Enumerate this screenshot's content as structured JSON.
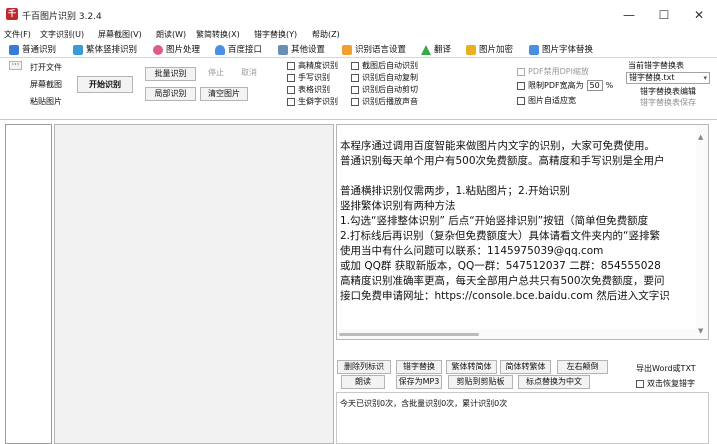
{
  "window": {
    "title": "千百图片识别 3.2.4",
    "app_icon_glyph": "千",
    "minimize_glyph": "—",
    "maximize_glyph": "☐",
    "close_glyph": "✕"
  },
  "menu": [
    "文件(F)",
    "文字识别(U)",
    "屏幕截图(V)",
    "朗读(W)",
    "繁简转换(X)",
    "错字替换(Y)",
    "帮助(Z)"
  ],
  "tabs": [
    {
      "label": "普通识别",
      "icon": "monitor-icon",
      "color": "#3a7bd5"
    },
    {
      "label": "繁体竖排识别",
      "icon": "grid-icon",
      "color": "#3a9bd5"
    },
    {
      "label": "图片处理",
      "icon": "palette-icon",
      "color": "#e05a8a"
    },
    {
      "label": "百度接口",
      "icon": "cloud-icon",
      "color": "#4a90e2"
    },
    {
      "label": "其他设置",
      "icon": "settings-icon",
      "color": "#6a8fb5"
    },
    {
      "label": "识别语言设置",
      "icon": "flag-icon",
      "color": "#f0a030"
    },
    {
      "label": "翻译",
      "icon": "translate-icon",
      "color": "#38a84a"
    },
    {
      "label": "图片加密",
      "icon": "lock-icon",
      "color": "#e8b020"
    },
    {
      "label": "图片字体替换",
      "icon": "font-icon",
      "color": "#4a90e2"
    }
  ],
  "toolbar": {
    "more_glyph": "···",
    "open_file": "打开文件",
    "screenshot": "屏幕截图",
    "paste_image": "粘贴图片",
    "start_recognize": "开始识别",
    "batch_recognize": "批量识别",
    "stop": "停止",
    "cancel": "取消",
    "partial_recognize": "局部识别",
    "clear_image": "清空图片",
    "checks_col1": [
      "高精度识别",
      "手写识别",
      "表格识别",
      "生僻字识别"
    ],
    "checks_col2": [
      "截图后自动识别",
      "识别后自动复制",
      "识别后自动剪切",
      "识别后播放声音"
    ],
    "pdf_dpi": "PDF禁用DPI缩放",
    "limit_pdf_width": "限制PDF宽高为",
    "limit_pdf_value": "50",
    "limit_pdf_unit": "%",
    "image_fit": "图片自适应宽",
    "typo_table_title": "当前错字替换表",
    "typo_table_value": "错字替换.txt",
    "typo_edit": "错字替换表编辑",
    "typo_save": "错字替换表保存"
  },
  "text_lines": [
    "本程序通过调用百度智能来做图片内文字的识别，大家可免费使用。",
    "普通识别每天单个用户有500次免费额度。高精度和手写识别是全用户",
    "",
    "普通横排识别仅需两步，1.粘贴图片；2.开始识别",
    "竖排繁体识别有两种方法",
    "1.勾选“竖排整体识别” 后点“开始竖排识别”按钮（简单但免费额度",
    "2.打标线后再识别（复杂但免费额度大）具体请看文件夹内的“竖排繁",
    "使用当中有什么问题可以联系：1145975039@qq.com",
    "或加 QQ群 获取新版本，QQ一群：547512037 二群：854555028",
    "高精度识别准确率更高，每天全部用户总共只有500次免费额度，要问",
    "接口免费申请网址：https://console.bce.baidu.com 然后进入文字识"
  ],
  "actions": {
    "row1": [
      "删除列标识",
      "错字替换",
      "繁体转简体",
      "简体转繁体",
      "左右颠倒"
    ],
    "export": "导出Word或TXT",
    "row2": [
      "朗读",
      "保存为MP3",
      "剪贴到剪贴板",
      "标点替换为中文"
    ],
    "double_click_restore": "双击恢复错字"
  },
  "status": {
    "usage_text": "今天已识别0次，含批量识别0次，累计识别0次"
  }
}
